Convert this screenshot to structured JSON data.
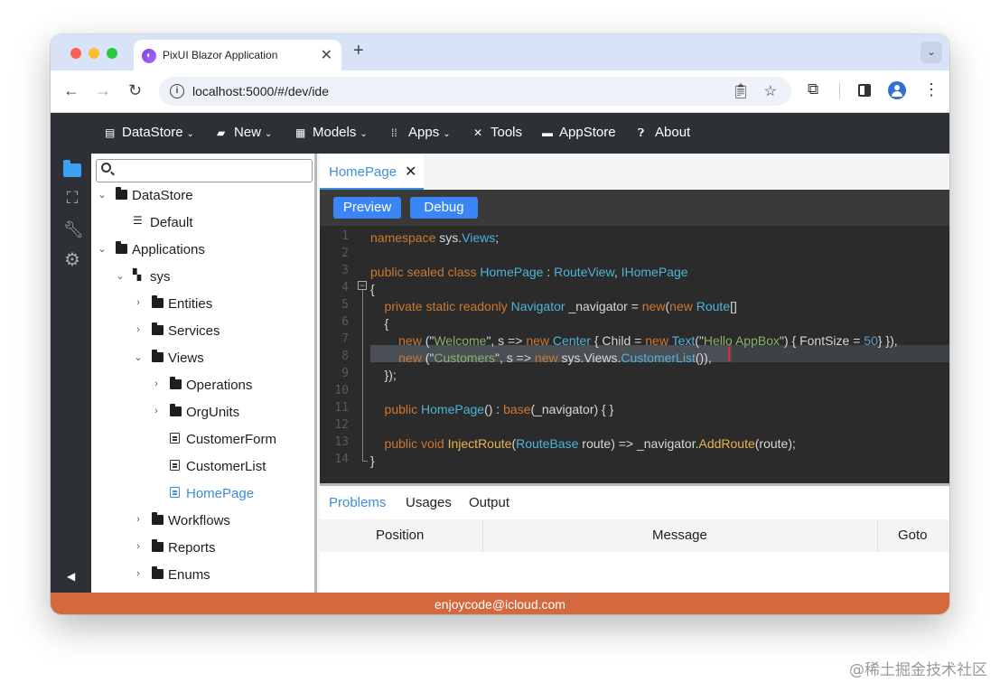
{
  "browser": {
    "tab_title": "PixUI Blazor Application",
    "url": "localhost:5000/#/dev/ide"
  },
  "menubar": {
    "items": [
      {
        "label": "DataStore",
        "icon": "datastore-icon",
        "caret": true
      },
      {
        "label": "New",
        "icon": "folder-plus-icon",
        "caret": true
      },
      {
        "label": "Models",
        "icon": "models-icon",
        "caret": true
      },
      {
        "label": "Apps",
        "icon": "apps-grid-icon",
        "caret": true
      },
      {
        "label": "Tools",
        "icon": "tools-icon",
        "caret": false
      },
      {
        "label": "AppStore",
        "icon": "store-icon",
        "caret": false
      },
      {
        "label": "About",
        "icon": "question-icon",
        "caret": false
      }
    ]
  },
  "sidebar": {
    "search_placeholder": "",
    "tree": [
      {
        "label": "DataStore",
        "icon": "folder-icon"
      },
      {
        "label": "Default",
        "icon": "database-icon"
      },
      {
        "label": "Applications",
        "icon": "folder-icon"
      },
      {
        "label": "sys",
        "icon": "app-icon"
      },
      {
        "label": "Entities",
        "icon": "folder-icon"
      },
      {
        "label": "Services",
        "icon": "folder-icon"
      },
      {
        "label": "Views",
        "icon": "folder-icon"
      },
      {
        "label": "Operations",
        "icon": "folder-icon"
      },
      {
        "label": "OrgUnits",
        "icon": "folder-icon"
      },
      {
        "label": "CustomerForm",
        "icon": "view-icon"
      },
      {
        "label": "CustomerList",
        "icon": "view-icon"
      },
      {
        "label": "HomePage",
        "icon": "view-icon",
        "selected": true
      },
      {
        "label": "Workflows",
        "icon": "folder-icon"
      },
      {
        "label": "Reports",
        "icon": "folder-icon"
      },
      {
        "label": "Enums",
        "icon": "folder-icon"
      }
    ]
  },
  "editor": {
    "tab_label": "HomePage",
    "preview_label": "Preview",
    "debug_label": "Debug",
    "line_numbers": [
      "1",
      "2",
      "3",
      "4",
      "5",
      "6",
      "7",
      "8",
      "9",
      "10",
      "11",
      "12",
      "13",
      "14"
    ]
  },
  "bottom_panel": {
    "tabs": [
      "Problems",
      "Usages",
      "Output"
    ],
    "columns": [
      "Position",
      "Message",
      "Goto"
    ]
  },
  "status": {
    "text": "enjoycode@icloud.com"
  },
  "watermark": "@稀土掘金技术社区",
  "colors": {
    "accent": "#3c8ee0",
    "statusbar": "#d4683e",
    "dark_bar": "#2d3135",
    "button": "#3a86f7"
  }
}
